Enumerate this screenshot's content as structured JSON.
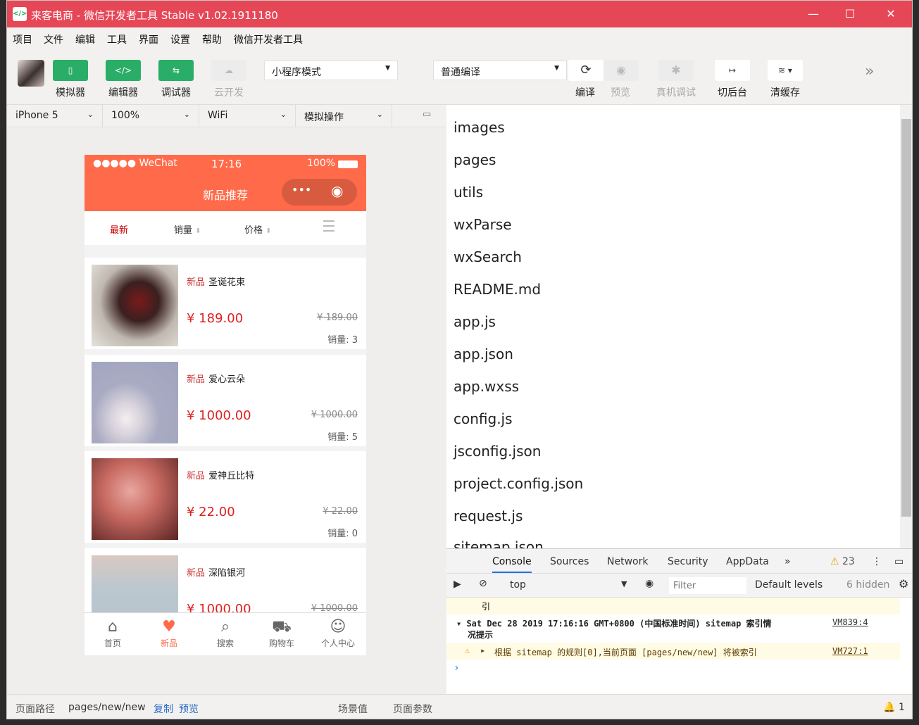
{
  "window": {
    "title": "来客电商 - 微信开发者工具 Stable v1.02.1911180",
    "minimize": "—",
    "maximize": "☐",
    "close": "✕"
  },
  "menu": [
    "项目",
    "文件",
    "编辑",
    "工具",
    "界面",
    "设置",
    "帮助",
    "微信开发者工具"
  ],
  "toolbar": {
    "simulator": "模拟器",
    "editor": "编辑器",
    "debugger": "调试器",
    "cloud": "云开发",
    "mode": "小程序模式",
    "compile_mode": "普通编译",
    "compile": "编译",
    "preview": "预览",
    "remote_debug": "真机调试",
    "background": "切后台",
    "clear_cache": "清缓存"
  },
  "simbar": {
    "device": "iPhone 5",
    "zoom": "100%",
    "network": "WiFi",
    "operation": "模拟操作"
  },
  "phone": {
    "carrier": "●●●●● WeChat",
    "time": "17:16",
    "battery": "100%",
    "nav_title": "新品推荐",
    "sort_tabs": [
      "最新",
      "销量",
      "价格"
    ],
    "products": [
      {
        "tag": "新品",
        "name": "圣诞花束",
        "price": "¥ 189.00",
        "old_price": "¥ 189.00",
        "sales": "销量: 3"
      },
      {
        "tag": "新品",
        "name": "爱心云朵",
        "price": "¥ 1000.00",
        "old_price": "¥ 1000.00",
        "sales": "销量: 5"
      },
      {
        "tag": "新品",
        "name": "爱神丘比特",
        "price": "¥ 22.00",
        "old_price": "¥ 22.00",
        "sales": "销量: 0"
      },
      {
        "tag": "新品",
        "name": "深陷银河",
        "price": "¥ 1000.00",
        "old_price": "¥ 1000.00",
        "sales": ""
      }
    ],
    "tabs": [
      "首页",
      "新品",
      "搜索",
      "购物车",
      "个人中心"
    ]
  },
  "files": [
    "images",
    "pages",
    "utils",
    "wxParse",
    "wxSearch",
    "README.md",
    "app.js",
    "app.json",
    "app.wxss",
    "config.js",
    "jsconfig.json",
    "project.config.json",
    "request.js",
    "sitemap.json"
  ],
  "devtools": {
    "tabs": [
      "Console",
      "Sources",
      "Network",
      "Security",
      "AppData"
    ],
    "warnings": "23",
    "context": "top",
    "filter_placeholder": "Filter",
    "levels": "Default levels",
    "hidden": "6 hidden",
    "log1_tail": "引",
    "log2": "Sat Dec 28 2019 17:16:16 GMT+0800 (中国标准时间) sitemap 索引情",
    "log2b": "况提示",
    "log2_src": "VM839:4",
    "log3": "根据 sitemap 的规则[0],当前页面 [pages/new/new] 将被索引",
    "log3_src": "VM727:1"
  },
  "footer": {
    "path_label": "页面路径",
    "path": "pages/new/new",
    "copy": "复制",
    "preview": "预览",
    "scene": "场景值",
    "params": "页面参数",
    "notif": "1"
  },
  "colors": {
    "title_bar": "#e64757",
    "brand_green": "#2aae67",
    "phone_header": "#ff6b4a",
    "price_red": "#e02020"
  }
}
